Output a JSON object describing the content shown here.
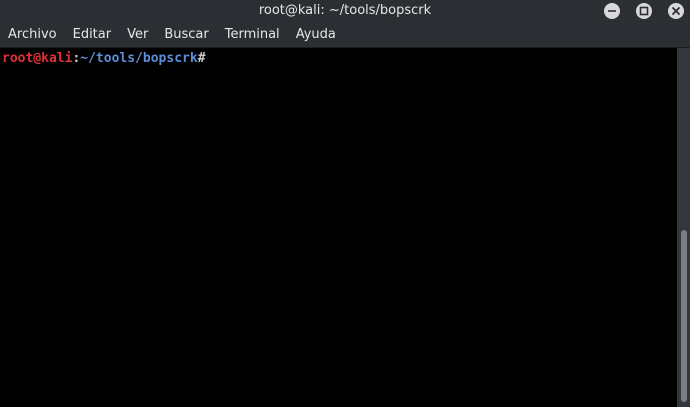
{
  "window": {
    "title": "root@kali: ~/tools/bopscrk"
  },
  "controls": {
    "minimize_icon": "minimize-icon",
    "maximize_icon": "maximize-icon",
    "close_icon": "close-icon"
  },
  "menu": {
    "items": [
      {
        "label": "Archivo"
      },
      {
        "label": "Editar"
      },
      {
        "label": "Ver"
      },
      {
        "label": "Buscar"
      },
      {
        "label": "Terminal"
      },
      {
        "label": "Ayuda"
      }
    ]
  },
  "terminal": {
    "prompt_user": "root@kali",
    "prompt_sep": ":",
    "prompt_path": "~/tools/bopscrk",
    "prompt_symbol": "#"
  },
  "colors": {
    "user": "#e0303a",
    "path": "#5c8fd6",
    "background": "#000000",
    "chrome": "#2b2e33"
  },
  "scrollbar": {
    "position_fraction": 0.51,
    "visible_fraction": 0.48
  }
}
